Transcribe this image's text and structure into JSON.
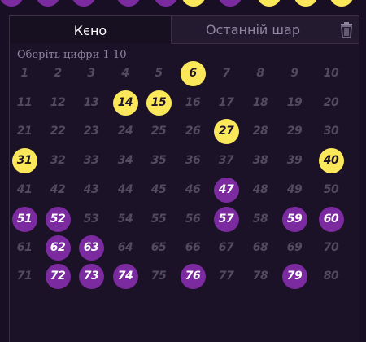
{
  "colors": {
    "background": "#190f24",
    "yellow_ball": "#fbe85a",
    "purple_ball": "#7b2aa0",
    "unselected_text": "#544a5f",
    "hint_text": "#8f86a0"
  },
  "top_strip": [
    "purple",
    "purple",
    "purple",
    "purple",
    "purple",
    "yellow",
    "purple",
    "yellow",
    "yellow",
    "yellow"
  ],
  "tabs": {
    "keno": "Кєно",
    "last_ball": "Останній шар"
  },
  "trash_icon": "trash-icon",
  "hint": "Оберіть цифри 1-10",
  "numbers": {
    "yellow": [
      6,
      14,
      15,
      27,
      31,
      40
    ],
    "purple": [
      47,
      51,
      52,
      57,
      59,
      60,
      62,
      63,
      72,
      73,
      74,
      76,
      79
    ]
  },
  "bottom_text": ""
}
